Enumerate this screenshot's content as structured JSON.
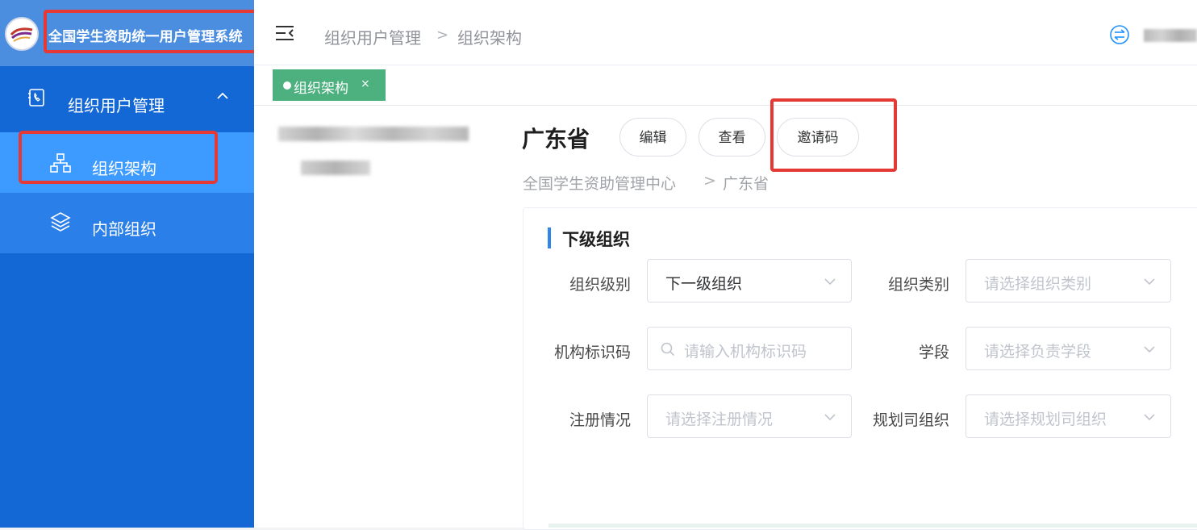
{
  "app": {
    "title": "全国学生资助统一用户管理系统"
  },
  "sidebar": {
    "parent_menu": {
      "label": "组织用户管理",
      "icon": "phone-book-icon"
    },
    "items": [
      {
        "label": "组织架构",
        "icon": "org-chart-icon",
        "active": true
      },
      {
        "label": "内部组织",
        "icon": "layers-icon",
        "active": false
      }
    ]
  },
  "header": {
    "breadcrumb": [
      "组织用户管理",
      "组织架构"
    ]
  },
  "tags": [
    {
      "label": "组织架构",
      "close": "×"
    }
  ],
  "org": {
    "name": "广东省",
    "buttons": {
      "edit": "编辑",
      "view": "查看",
      "invite": "邀请码"
    },
    "path": [
      "全国学生资助管理中心",
      "广东省"
    ]
  },
  "panel": {
    "title": "下级组织",
    "filters": {
      "level": {
        "label": "组织级别",
        "value": "下一级组织"
      },
      "category": {
        "label": "组织类别",
        "placeholder": "请选择组织类别"
      },
      "code": {
        "label": "机构标识码",
        "placeholder": "请输入机构标识码"
      },
      "stage": {
        "label": "学段",
        "placeholder": "请选择负责学段"
      },
      "registered": {
        "label": "注册情况",
        "placeholder": "请选择注册情况"
      },
      "planning": {
        "label": "规划司组织",
        "placeholder": "请选择规划司组织"
      }
    }
  },
  "colors": {
    "sidebar_bg": "#1468d6",
    "sidebar_active": "#3d9bff",
    "tag_green": "#4cb07f",
    "highlight_red": "#e53935",
    "accent_bar": "#2f86e8"
  }
}
